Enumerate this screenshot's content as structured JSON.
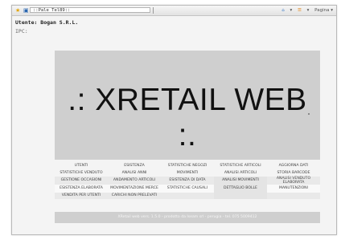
{
  "browser": {
    "tab_label": "::Pale Tel89::",
    "toolbar_right": [
      "⌂",
      "▾",
      "☰",
      "▾",
      "Pagina ▾"
    ]
  },
  "page": {
    "welcome": "Utente: Bogan S.R.L.",
    "subtext": "IPC:"
  },
  "logo": ".: XRETAIL WEB :.",
  "menu": {
    "items": [
      "Utenti",
      "Esistenza",
      "Statistiche negozi",
      "Statistiche articoli",
      "Aggiorna dati",
      "Statistiche venduto",
      "Analisi anni",
      "Movimenti",
      "Analisi articoli",
      "Storia barcode",
      "Gestione occasioni",
      "Andamento articoli",
      "Esistenza di data",
      "Analisi movimenti",
      "Analisi venduto elaborata",
      "Esistenza elaborata",
      "Movimentazione merce",
      "Statistiche causali",
      "Dettaglio bolle",
      "Manutenzioni",
      "Vendita per utenti",
      "Carichi non prelevati",
      "",
      "",
      ""
    ]
  },
  "footer": "XRetail web vers. 1.5.0 - prodotto da Iseam srl - perugia - tel. 075 5009412"
}
